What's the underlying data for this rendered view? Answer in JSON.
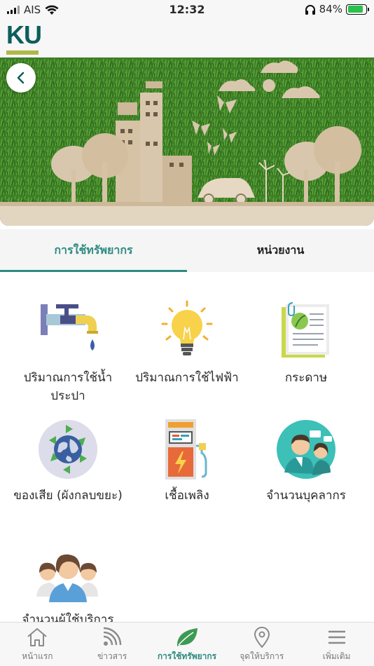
{
  "status_bar": {
    "carrier": "AIS",
    "time": "12:32",
    "battery_percent": "84%",
    "battery_level": 0.84,
    "battery_color": "#2bc04c"
  },
  "header": {
    "logo_text": "KU",
    "logo_color": "#0d5e5b",
    "logo_accent": "#b1b84a"
  },
  "banner": {
    "back_icon": "chevron-left-icon"
  },
  "tabs": [
    {
      "label": "การใช้ทรัพยากร",
      "active": true
    },
    {
      "label": "หน่วยงาน",
      "active": false
    }
  ],
  "accent_color": "#2e8b81",
  "grid_items": [
    {
      "label": "ปริมาณการใช้น้ำประปา",
      "icon": "water-tap-icon"
    },
    {
      "label": "ปริมาณการใช้ไฟฟ้า",
      "icon": "light-bulb-icon"
    },
    {
      "label": "กระดาษ",
      "icon": "paper-document-icon"
    },
    {
      "label": "ของเสีย (ผังกลบขยะ)",
      "icon": "recycle-globe-icon"
    },
    {
      "label": "เชื้อเพลิง",
      "icon": "fuel-pump-icon"
    },
    {
      "label": "จำนวนบุคลากร",
      "icon": "staff-people-icon"
    },
    {
      "label": "จำนวนผู้ใช้บริการ",
      "icon": "service-users-icon"
    }
  ],
  "bottom_nav": [
    {
      "label": "หน้าแรก",
      "icon": "home-icon",
      "active": false
    },
    {
      "label": "ข่าวสาร",
      "icon": "rss-icon",
      "active": false
    },
    {
      "label": "การใช้ทรัพยากร",
      "icon": "leaf-icon",
      "active": true
    },
    {
      "label": "จุดให้บริการ",
      "icon": "location-pin-icon",
      "active": false
    },
    {
      "label": "เพิ่มเติม",
      "icon": "menu-icon",
      "active": false
    }
  ]
}
